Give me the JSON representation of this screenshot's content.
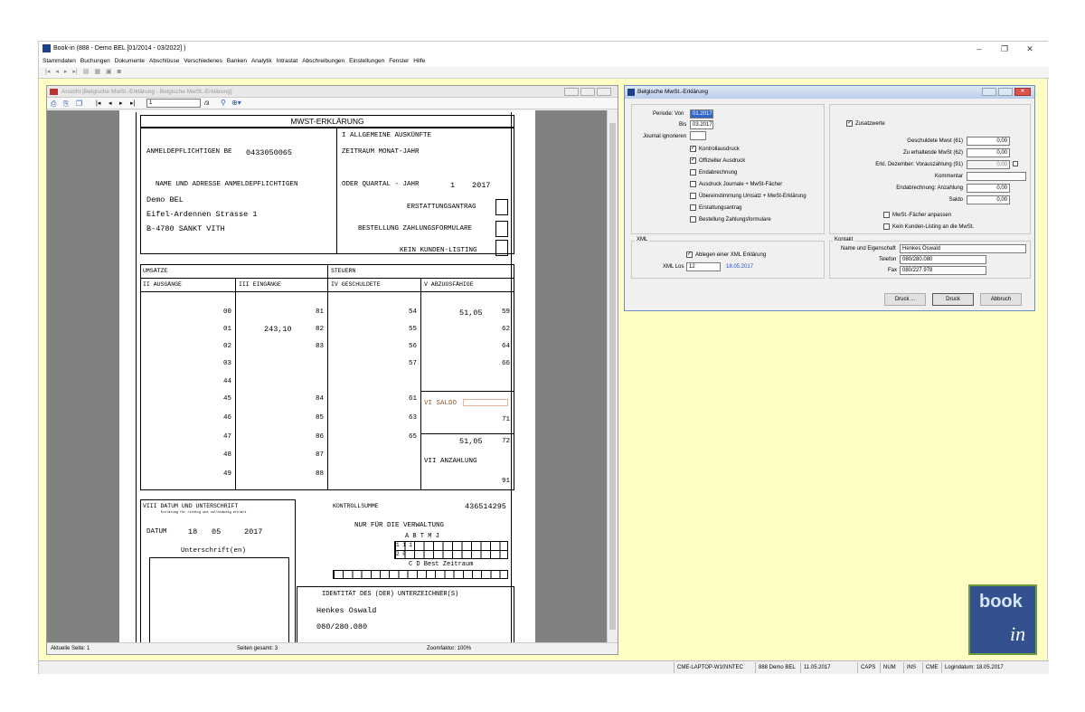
{
  "app": {
    "title": "Book-in (888 - Demo BEL [01/2014 - 03/2022] )",
    "menu": [
      "Stammdaten",
      "Buchungen",
      "Dokumente",
      "Abschlüsse",
      "Verschiedenes",
      "Banken",
      "Analytik",
      "Intrastat",
      "Abschreibungen",
      "Einstellungen",
      "Fenster",
      "Hilfe"
    ],
    "window_controls": {
      "minimize": "–",
      "restore": "❐",
      "close": "✕"
    }
  },
  "preview": {
    "title": "Ansicht [Belgische MwSt.-Erklärung - Belgische MwSt.-Erklärung]",
    "page_input": "1",
    "page_total": "/3",
    "status": {
      "current": "Aktuelle Seite: 1",
      "total": "Seiten gesamt: 3",
      "zoom": "Zoomfaktor: 100%"
    }
  },
  "form": {
    "title": "MWST-ERKLÄRUNG",
    "anmeldepflichtigen_label": "ANMELDEPFLICHTIGEN BE",
    "vat_number": "0433050065",
    "section_i": "I  ALLGEMEINE AUSKÜNFTE",
    "zeitraum": "ZEITRAUM MONAT-JAHR",
    "name_adresse": "NAME UND ADRESSE ANMELDEPFLICHTIGEN",
    "company": "Demo BEL",
    "street": "Eifel-Ardennen Strasse 1",
    "city": "B-4780 SANKT VITH",
    "oder_quartal": "ODER QUARTAL - JAHR",
    "quartal": "1",
    "jahr": "2017",
    "erstattungsantrag": "ERSTATTUNGSANTRAG",
    "bestellung": "BESTELLUNG ZAHLUNGSFORMULARE",
    "kein_kunden": "KEIN KUNDEN-LISTING",
    "umsaetze": "UMSÄTZE",
    "steuern": "STEUERN",
    "col_ii": "II AUSGÄNGE",
    "col_iii": "III EINGÄNGE",
    "col_iv": "IV GESCHULDETE",
    "col_v": "V ABZUGSFÄHIGE",
    "ii_codes": [
      "00",
      "01",
      "02",
      "03",
      "44",
      "45",
      "46",
      "47",
      "48",
      "49"
    ],
    "iii_codes": [
      "81",
      "82",
      "83",
      "84",
      "85",
      "86",
      "87",
      "88"
    ],
    "iii_value_82": "243,10",
    "iv_codes": [
      "54",
      "55",
      "56",
      "57",
      "61",
      "63",
      "65"
    ],
    "v_codes": [
      "59",
      "62",
      "64",
      "66"
    ],
    "v_value_59": "51,05",
    "vi_saldo": "VI SALDO",
    "vi_codes": [
      "71",
      "72"
    ],
    "vi_value_72": "51,05",
    "vii_anzahlung": "VII ANZAHLUNG",
    "vii_code": "91",
    "viii_title": "VIII DATUM UND UNTERSCHRIFT",
    "viii_sub": "Erklärung für richtig und vollständig erklärt",
    "datum_label": "DATUM",
    "datum_day": "18",
    "datum_month": "05",
    "datum_year": "2017",
    "unterschrift": "Unterschrift(en)",
    "kontrollsumme_label": "KONTROLLSUMME",
    "kontrollsumme": "436514295",
    "verwaltung": "NUR FÜR DIE VERWALTUNG",
    "abtmj": "A B  T   M    J",
    "grid_row1": "1 1 1",
    "grid_row2": "2      0",
    "cd_best": "C D  Best Zeitraum",
    "identitaet": "IDENTITÄT DES (DER) UNTERZEICHNER(S)",
    "signer_name": "Henkes Oswald",
    "signer_phone": "080/280.080"
  },
  "dialog": {
    "title": "Belgische MwSt.-Erklärung",
    "periode_von_label": "Periode: Von",
    "periode_von": "01.2017",
    "bis_label": "Bis",
    "bis": "03.2017",
    "journal_label": "Journal ignorieren",
    "checks_left": [
      {
        "label": "Kontrollausdruck",
        "checked": true
      },
      {
        "label": "Offizieller Ausdruck",
        "checked": true
      },
      {
        "label": "Endabrechnung",
        "checked": false
      },
      {
        "label": "Ausdruck Journale + MwSt-Fächer",
        "checked": false
      },
      {
        "label": "Übereinstimmung Umsatz + MwSt-Erklärung",
        "checked": false
      },
      {
        "label": "Erstattungsantrag",
        "checked": false
      },
      {
        "label": "Bestellung Zahlungsformulare",
        "checked": false
      }
    ],
    "zusatzwerte": "Zusatzwerte",
    "right_fields": [
      {
        "label": "Geschuldete Mwst (61)",
        "value": "0,00"
      },
      {
        "label": "Zu erhaltende MwSt (62)",
        "value": "0,00"
      },
      {
        "label": "Erkl. Dezember: Vorauszahlung (91)",
        "value": "0,00"
      },
      {
        "label": "Kommentar",
        "value": ""
      },
      {
        "label": "Endabrechnung: Anzahlung",
        "value": "0,00"
      },
      {
        "label": "Saldo",
        "value": "0,00"
      }
    ],
    "mwst_faecher": "MwSt.-Fächer anpassen",
    "kein_listing": "Kein Kunden-Listing an die MwSt.",
    "xml_group": "XML",
    "ablegen": "Ablegen einer XML Erklärung",
    "xml_los_label": "XML Los",
    "xml_los": "12",
    "xml_date": "18.05.2017",
    "kontakt_group": "Kontakt",
    "name_label": "Name und Eigenschaft",
    "name_value": "Henkes Oswald",
    "telefon_label": "Telefon",
    "telefon_value": "080/280.080",
    "fax_label": "Fax",
    "fax_value": "080/227.978",
    "btn_druck_dots": "Druck ...",
    "btn_druck": "Druck",
    "btn_abbruch": "Abbruch"
  },
  "status_bar": [
    "CME-LAPTOP-W10\\INTEC",
    "888 Demo BEL",
    "11.05.2017",
    "CAPS",
    "NUM",
    "INS",
    "CME",
    "Logindatum: 18.05.2017"
  ],
  "logo": {
    "text": "book",
    "sub": "in"
  },
  "colors": {
    "background": "#fffec4",
    "logo_blue": "#33508f",
    "logo_green": "#6a9e3c",
    "date_blue": "#1f4fd0"
  }
}
